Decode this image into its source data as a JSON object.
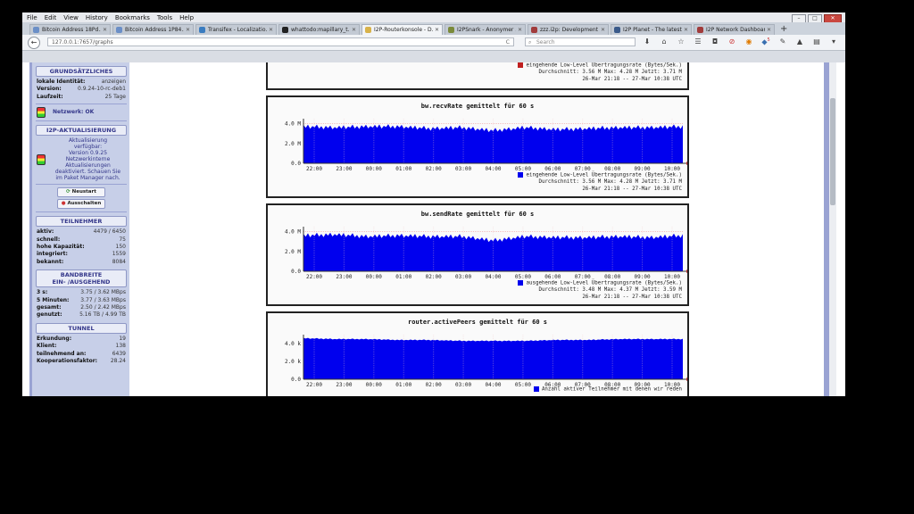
{
  "menubar": {
    "items": [
      "File",
      "Edit",
      "View",
      "History",
      "Bookmarks",
      "Tools",
      "Help"
    ]
  },
  "tabs": [
    {
      "label": "Bitcoin Address 18Pd...",
      "color": "#6b8fc7"
    },
    {
      "label": "Bitcoin Address 1P84...",
      "color": "#6b8fc7"
    },
    {
      "label": "Transifex - Localizatio...",
      "color": "#3a7cc0"
    },
    {
      "label": "whattodo:mapillary_t...",
      "color": "#222222"
    },
    {
      "label": "I2P-Routerkonsole - D...",
      "color": "#d8b24a",
      "active": true
    },
    {
      "label": "I2PSnark - Anonymer ...",
      "color": "#7a8a3a"
    },
    {
      "label": "zzz.i2p: Development ...",
      "color": "#a13b3b"
    },
    {
      "label": "I2P Planet - The latest...",
      "color": "#3a5a8a"
    },
    {
      "label": "I2P Network Dashboard",
      "color": "#a13b3b"
    }
  ],
  "navbar": {
    "url": "127.0.0.1:7657/graphs",
    "search_placeholder": "Search",
    "reload": "C",
    "badge": "5"
  },
  "sidebar": {
    "general_title": "GRUNDSÄTZLICHES",
    "general": [
      {
        "k": "lokale Identität:",
        "v": "anzeigen"
      },
      {
        "k": "Version:",
        "v": "0.9.24-10-rc-deb1"
      },
      {
        "k": "Laufzeit:",
        "v": "25 Tage"
      }
    ],
    "network": "Netzwerk: OK",
    "update_title": "I2P-AKTUALISIERUNG",
    "update_text": [
      "Aktualisierung",
      "verfügbar:",
      "Version 0.9.25",
      "Netzwerkinterne",
      "Aktualisierungen",
      "deaktiviert. Schauen Sie",
      "im Paket Manager nach."
    ],
    "restart": "Neustart",
    "shutdown": "Ausschalten",
    "peers_title": "TEILNEHMER",
    "peers": [
      {
        "k": "aktiv:",
        "v": "4479 / 6450"
      },
      {
        "k": "schnell:",
        "v": "75"
      },
      {
        "k": "hohe Kapazität:",
        "v": "150"
      },
      {
        "k": "integriert:",
        "v": "1559"
      },
      {
        "k": "bekannt:",
        "v": "8084"
      }
    ],
    "bw_title_1": "BANDBREITE",
    "bw_title_2": "EIN- /AUSGEHEND",
    "bandwidth": [
      {
        "k": "3 s:",
        "v": "3.75 / 3.62 MBps"
      },
      {
        "k": "5 Minuten:",
        "v": "3.77 / 3.63 MBps"
      },
      {
        "k": "gesamt:",
        "v": "2.50 / 2.42 MBps"
      },
      {
        "k": "genutzt:",
        "v": "5.16 TB / 4.99 TB"
      }
    ],
    "tunnel_title": "TUNNEL",
    "tunnels": [
      {
        "k": "Erkundung:",
        "v": "19"
      },
      {
        "k": "Klient:",
        "v": "138"
      },
      {
        "k": "teilnehmend an:",
        "v": "6439"
      },
      {
        "k": "Kooperationsfaktor:",
        "v": "28.24"
      }
    ]
  },
  "graph_top_legend": {
    "line1": "eingehende Low-Level Übertragungsrate (Bytes/Sek.)",
    "line2": "Durchschnitt: 3.56 M   Max: 4.28 M   Jetzt: 3.71 M",
    "line3": "26-Mar 21:18 -- 27-Mar 10:38 UTC"
  },
  "chart_data": [
    {
      "type": "area",
      "title": "bw.recvRate gemittelt für 60 s",
      "categories": [
        "22:00",
        "23:00",
        "00:00",
        "01:00",
        "02:00",
        "03:00",
        "04:00",
        "05:00",
        "06:00",
        "07:00",
        "08:00",
        "09:00",
        "10:00"
      ],
      "yticks": [
        "0.0",
        "2.0 M",
        "4.0 M"
      ],
      "ylim": [
        0,
        4.5
      ],
      "series": [
        {
          "name": "eingehende Low-Level Übertragungsrate (Bytes/Sek.)",
          "values": [
            3.7,
            3.6,
            3.7,
            3.7,
            3.5,
            3.6,
            3.3,
            3.6,
            3.4,
            3.5,
            3.6,
            3.6,
            3.7
          ]
        }
      ],
      "legend": [
        "eingehende Low-Level Übertragungsrate (Bytes/Sek.)",
        "Durchschnitt: 3.56 M   Max: 4.28 M   Jetzt: 3.71 M",
        "26-Mar 21:18 -- 27-Mar 10:38 UTC"
      ],
      "color": "#0000ee"
    },
    {
      "type": "area",
      "title": "bw.sendRate gemittelt für 60 s",
      "categories": [
        "22:00",
        "23:00",
        "00:00",
        "01:00",
        "02:00",
        "03:00",
        "04:00",
        "05:00",
        "06:00",
        "07:00",
        "08:00",
        "09:00",
        "10:00"
      ],
      "yticks": [
        "0.0",
        "2.0 M",
        "4.0 M"
      ],
      "ylim": [
        0,
        4.5
      ],
      "series": [
        {
          "name": "ausgehende Low-Level Übertragungsrate (Bytes/Sek.)",
          "values": [
            3.6,
            3.7,
            3.5,
            3.6,
            3.5,
            3.5,
            3.1,
            3.5,
            3.4,
            3.4,
            3.5,
            3.4,
            3.6
          ]
        }
      ],
      "legend": [
        "ausgehende Low-Level Übertragungsrate (Bytes/Sek.)",
        "Durchschnitt: 3.48 M   Max: 4.37 M   Jetzt: 3.59 M",
        "26-Mar 21:18 -- 27-Mar 10:38 UTC"
      ],
      "color": "#0000ee"
    },
    {
      "type": "area",
      "title": "router.activePeers gemittelt für 60 s",
      "categories": [
        "22:00",
        "23:00",
        "00:00",
        "01:00",
        "02:00",
        "03:00",
        "04:00",
        "05:00",
        "06:00",
        "07:00",
        "08:00",
        "09:00",
        "10:00"
      ],
      "yticks": [
        "0.0",
        "2.0 k",
        "4.0 k"
      ],
      "ylim": [
        0,
        5
      ],
      "series": [
        {
          "name": "Anzahl aktiver Teilnehmer mit denen wir reden",
          "values": [
            4.6,
            4.5,
            4.5,
            4.4,
            4.4,
            4.3,
            4.3,
            4.3,
            4.4,
            4.4,
            4.5,
            4.5,
            4.5
          ]
        }
      ],
      "legend": [
        "Anzahl aktiver Teilnehmer mit denen wir reden"
      ],
      "color": "#0000ee"
    }
  ]
}
